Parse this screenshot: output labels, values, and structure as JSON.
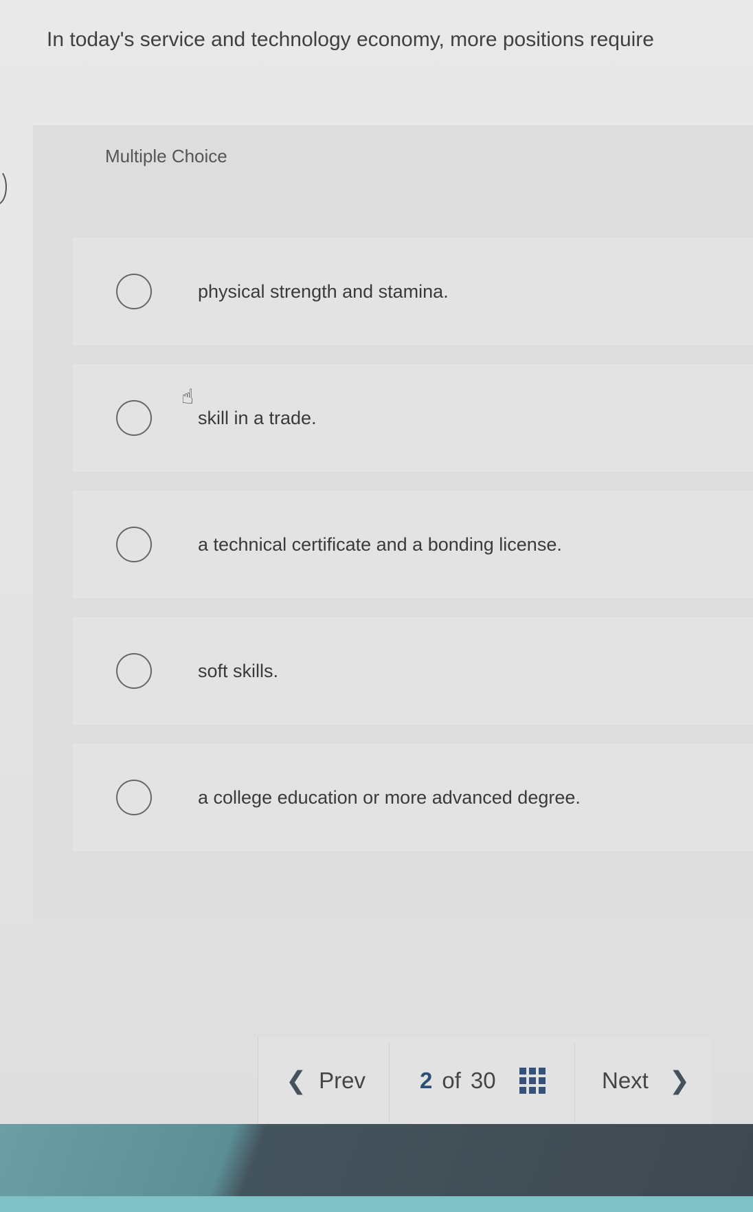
{
  "question": {
    "text": "In today's service and technology economy, more positions require"
  },
  "multiple_choice": {
    "label": "Multiple Choice",
    "options": [
      {
        "text": "physical strength and stamina."
      },
      {
        "text": "skill in a trade."
      },
      {
        "text": "a technical certificate and a bonding license."
      },
      {
        "text": "soft skills."
      },
      {
        "text": "a college education or more advanced degree."
      }
    ]
  },
  "navigation": {
    "prev_label": "Prev",
    "current": "2",
    "of_label": "of",
    "total": "30",
    "next_label": "Next"
  },
  "icons": {
    "prev": "chevron-left-icon",
    "next": "chevron-right-icon",
    "overview": "grid-icon",
    "cursor": "hand-pointer-icon"
  },
  "colors": {
    "accent": "#35517a"
  }
}
